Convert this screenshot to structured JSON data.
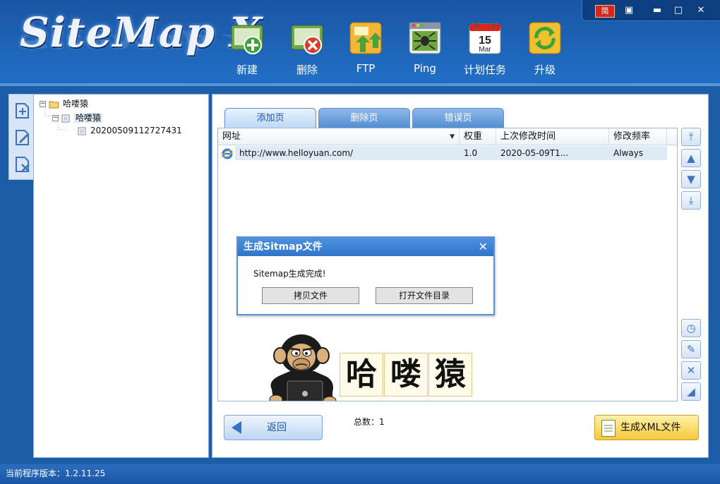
{
  "app": {
    "logo_text": "SiteMap X"
  },
  "window_controls": {
    "language_label": "简",
    "restore": "▣",
    "minimize": "▬",
    "maximize": "□",
    "close": "✕"
  },
  "toolbar": [
    {
      "label": "新建",
      "icon": "new-project-icon"
    },
    {
      "label": "删除",
      "icon": "delete-project-icon"
    },
    {
      "label": "FTP",
      "icon": "ftp-upload-icon"
    },
    {
      "label": "Ping",
      "icon": "ping-spider-icon"
    },
    {
      "label": "计划任务",
      "icon": "calendar-icon",
      "calendar_day": "15",
      "calendar_month": "Mar"
    },
    {
      "label": "升级",
      "icon": "upgrade-refresh-icon"
    }
  ],
  "tree": {
    "root": "哈喽猿",
    "child": "哈喽猿",
    "leaf": "20200509112727431"
  },
  "tabs": [
    {
      "label": "添加页",
      "active": true
    },
    {
      "label": "删除页",
      "active": false
    },
    {
      "label": "错误页",
      "active": false
    }
  ],
  "grid": {
    "columns": [
      "网址",
      "权重",
      "上次修改时间",
      "修改频率"
    ],
    "rows": [
      {
        "url": "http://www.helloyuan.com/",
        "weight": "1.0",
        "modified": "2020-05-09T1...",
        "frequency": "Always"
      }
    ]
  },
  "dialog": {
    "title": "生成Sitmap文件",
    "message": "Sitemap生成完成!",
    "copy_button": "拷贝文件",
    "open_dir_button": "打开文件目录"
  },
  "brand": {
    "chars": [
      "哈",
      "喽",
      "猿"
    ]
  },
  "footer": {
    "back_button": "返回",
    "total": "总数：1",
    "generate_button": "生成XML文件"
  },
  "status_bar": {
    "version": "当前程序版本：1.2.11.25"
  },
  "colors": {
    "header": "#1e64b8",
    "accent": "#2f74c8",
    "generate": "#f6c83a"
  }
}
